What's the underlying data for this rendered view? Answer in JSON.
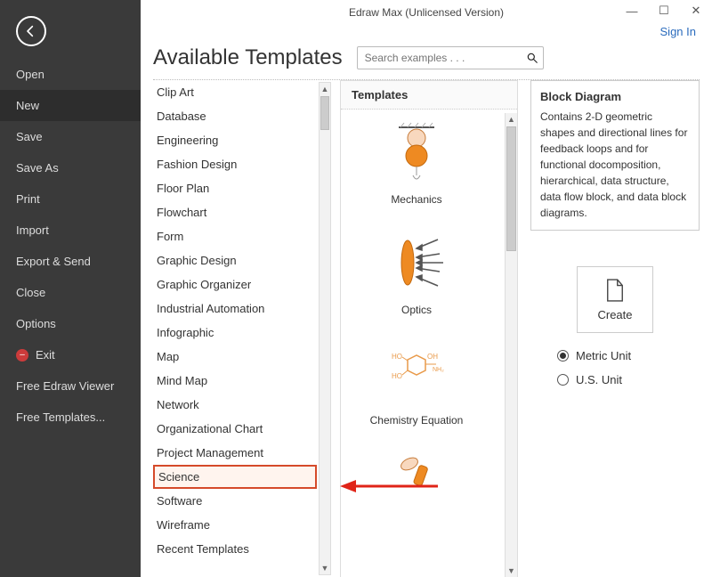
{
  "window": {
    "title": "Edraw Max (Unlicensed Version)",
    "signin": "Sign In"
  },
  "sidebar": {
    "items": [
      {
        "label": "Open"
      },
      {
        "label": "New"
      },
      {
        "label": "Save"
      },
      {
        "label": "Save As"
      },
      {
        "label": "Print"
      },
      {
        "label": "Import"
      },
      {
        "label": "Export & Send"
      },
      {
        "label": "Close"
      },
      {
        "label": "Options"
      }
    ],
    "exit_label": "Exit",
    "extra": [
      {
        "label": "Free Edraw Viewer"
      },
      {
        "label": "Free Templates..."
      }
    ]
  },
  "page": {
    "title": "Available Templates",
    "search_placeholder": "Search examples . . ."
  },
  "categories": [
    "Clip Art",
    "Database",
    "Engineering",
    "Fashion Design",
    "Floor Plan",
    "Flowchart",
    "Form",
    "Graphic Design",
    "Graphic Organizer",
    "Industrial Automation",
    "Infographic",
    "Map",
    "Mind Map",
    "Network",
    "Organizational Chart",
    "Project Management",
    "Science",
    "Software",
    "Wireframe",
    "Recent Templates"
  ],
  "highlighted_category_index": 16,
  "templates": {
    "header": "Templates",
    "items": [
      {
        "label": "Mechanics"
      },
      {
        "label": "Optics"
      },
      {
        "label": "Chemistry Equation"
      }
    ]
  },
  "detail": {
    "title": "Block Diagram",
    "description": "Contains 2-D geometric shapes and directional lines for feedback loops and for functional docomposition, hierarchical, data structure, data flow block, and data block diagrams."
  },
  "create_label": "Create",
  "units": {
    "metric": "Metric Unit",
    "us": "U.S. Unit",
    "selected": "metric"
  }
}
